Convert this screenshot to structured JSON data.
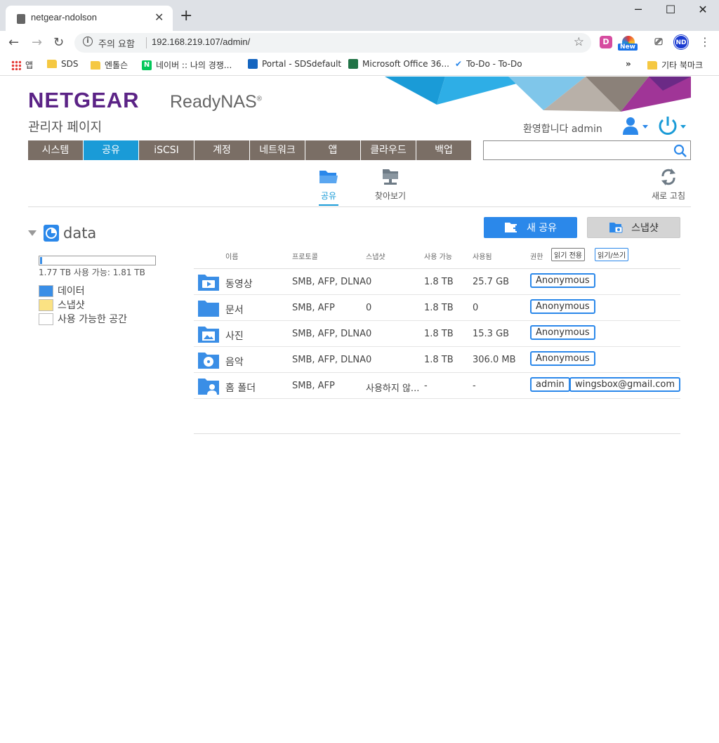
{
  "browser": {
    "tab_title": "netgear-ndolson",
    "security_warning": "주의 요함",
    "url": "192.168.219.107/admin/",
    "bookmarks": [
      {
        "label": "앱"
      },
      {
        "label": "SDS"
      },
      {
        "label": "엔톨슨"
      },
      {
        "label": "네이버 :: 나의 경쟁..."
      },
      {
        "label": "Portal - SDSdefault"
      },
      {
        "label": "Microsoft Office 36..."
      },
      {
        "label": "To-Do - To-Do"
      }
    ],
    "overflow": "»",
    "other_bookmarks": "기타 북마크",
    "new_badge": "New",
    "profile_initials": "ND",
    "ext_d": "D"
  },
  "header": {
    "brand": "NETGEAR",
    "product": "ReadyNAS",
    "product_mark": "®",
    "subtitle": "관리자 페이지",
    "welcome": "환영합니다 admin"
  },
  "nav": {
    "items": [
      {
        "label": "시스템"
      },
      {
        "label": "공유"
      },
      {
        "label": "iSCSI"
      },
      {
        "label": "계정"
      },
      {
        "label": "네트워크"
      },
      {
        "label": "앱"
      },
      {
        "label": "클라우드"
      },
      {
        "label": "백업"
      }
    ],
    "active_index": 1
  },
  "subnav": {
    "tabs": [
      {
        "label": "공유"
      },
      {
        "label": "찾아보기"
      }
    ],
    "refresh": "새로 고침"
  },
  "volume": {
    "name": "data",
    "usage_text": "1.77 TB 사용 가능: 1.81 TB",
    "usage_fraction": 0.02,
    "legend": [
      {
        "label": "데이터",
        "color": "#3a8ee6"
      },
      {
        "label": "스냅샷",
        "color": "#fbe283"
      },
      {
        "label": "사용 가능한 공간",
        "color": "#ffffff"
      }
    ]
  },
  "actions": {
    "new_share": "새 공유",
    "snapshot": "스냅샷"
  },
  "table": {
    "headers": {
      "name": "이름",
      "protocol": "프로토콜",
      "snapshot": "스냅샷",
      "available": "사용 가능",
      "used": "사용됨",
      "permission": "권한",
      "read_only": "읽기 전용",
      "read_write": "읽기/쓰기"
    },
    "rows": [
      {
        "name": "동영상",
        "protocol": "SMB, AFP, DLNA",
        "snapshot": "0",
        "available": "1.8 TB",
        "used": "25.7 GB",
        "perms": [
          "Anonymous"
        ],
        "icon": "video-folder-icon"
      },
      {
        "name": "문서",
        "protocol": "SMB, AFP",
        "snapshot": "0",
        "available": "1.8 TB",
        "used": "0",
        "perms": [
          "Anonymous"
        ],
        "icon": "folder-icon"
      },
      {
        "name": "사진",
        "protocol": "SMB, AFP, DLNA",
        "snapshot": "0",
        "available": "1.8 TB",
        "used": "15.3 GB",
        "perms": [
          "Anonymous"
        ],
        "icon": "photo-folder-icon"
      },
      {
        "name": "음악",
        "protocol": "SMB, AFP, DLNA",
        "snapshot": "0",
        "available": "1.8 TB",
        "used": "306.0 MB",
        "perms": [
          "Anonymous"
        ],
        "icon": "music-folder-icon"
      },
      {
        "name": "홈 폴더",
        "protocol": "SMB, AFP",
        "snapshot": "사용하지 않...",
        "available": "-",
        "used": "-",
        "perms": [
          "admin",
          "wingsbox@gmail.com"
        ],
        "icon": "home-folder-icon"
      }
    ]
  },
  "colors": {
    "brand": "#5b2386",
    "accent": "#1a9bd7",
    "nav_bg": "#7a6e65",
    "button_blue": "#2b88ea"
  }
}
